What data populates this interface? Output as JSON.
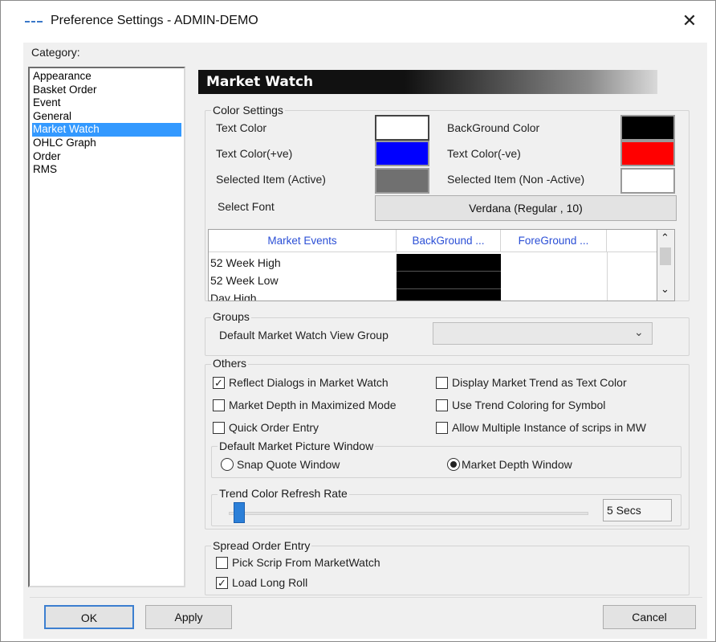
{
  "window": {
    "title": "Preference Settings - ADMIN-DEMO",
    "close_symbol": "✕"
  },
  "category": {
    "label": "Category:",
    "items": [
      "Appearance",
      "Basket Order",
      "Event",
      "General",
      "Market Watch",
      "OHLC Graph",
      "Order",
      "RMS"
    ],
    "selected": "Market Watch"
  },
  "page": {
    "header": "Market Watch"
  },
  "color_settings": {
    "title": "Color Settings",
    "text_color_label": "Text Color",
    "text_color": "#ffffff",
    "background_color_label": "BackGround Color",
    "background_color": "#000000",
    "text_color_pos_label": "Text Color(+ve)",
    "text_color_pos": "#0000ff",
    "text_color_neg_label": "Text Color(-ve)",
    "text_color_neg": "#ff0000",
    "selected_active_label": "Selected Item (Active)",
    "selected_active": "#707070",
    "selected_nonactive_label": "Selected Item (Non -Active)",
    "selected_nonactive": "#ffffff",
    "select_font_label": "Select Font",
    "font_button": "Verdana (Regular , 10)"
  },
  "events_table": {
    "columns": [
      "Market Events",
      "BackGround ...",
      "ForeGround ..."
    ],
    "rows": [
      {
        "event": "52 Week High",
        "background": "#000000",
        "foreground": "#ffffff"
      },
      {
        "event": "52 Week Low",
        "background": "#000000",
        "foreground": "#ffffff"
      },
      {
        "event": "Day High",
        "background": "#000000",
        "foreground": "#ffffff"
      }
    ],
    "scroll_up": "⌃",
    "scroll_down": "⌄"
  },
  "groups": {
    "title": "Groups",
    "default_view_label": "Default Market Watch View Group",
    "default_view_value": "",
    "chevron": "⌄"
  },
  "others": {
    "title": "Others",
    "options": [
      {
        "label": "Reflect Dialogs in Market Watch",
        "checked": true
      },
      {
        "label": "Display Market Trend as Text Color",
        "checked": false
      },
      {
        "label": "Market Depth in Maximized Mode",
        "checked": false
      },
      {
        "label": "Use Trend Coloring for Symbol",
        "checked": false
      },
      {
        "label": "Quick Order Entry",
        "checked": false
      },
      {
        "label": "Allow Multiple Instance of scrips in MW",
        "checked": false
      }
    ],
    "check_mark": "✓",
    "picture_window": {
      "title": "Default Market Picture Window",
      "snap_quote": "Snap Quote Window",
      "market_depth": "Market Depth Window",
      "selected": "Market Depth Window"
    },
    "trend_refresh": {
      "title": "Trend Color Refresh Rate",
      "value": "5 Secs",
      "slider_level": 0.02
    }
  },
  "spread_order": {
    "title": "Spread Order Entry",
    "pick_scrip_label": "Pick Scrip From MarketWatch",
    "pick_scrip_checked": false,
    "load_long_roll_label": "Load Long Roll",
    "load_long_roll_checked": true
  },
  "footer": {
    "ok": "OK",
    "apply": "Apply",
    "cancel": "Cancel"
  }
}
